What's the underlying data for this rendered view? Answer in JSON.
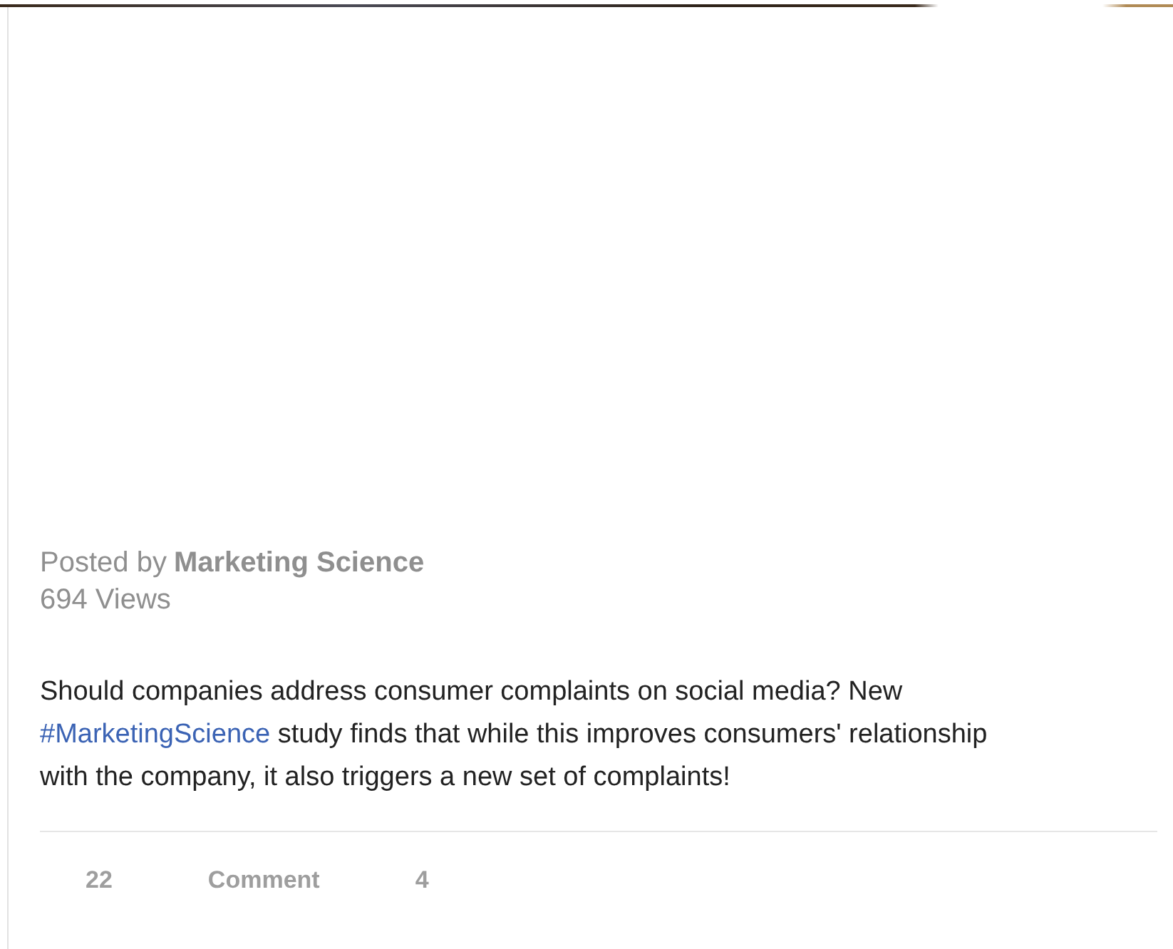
{
  "post": {
    "posted_by_label": "Posted by",
    "author": "Marketing Science",
    "views": "694 Views",
    "body": {
      "before": "Should companies address consumer complaints on social media? New",
      "hashtag": "#MarketingScience",
      "after": "study finds that while this improves consumers' relationship with the company, it also triggers a new set of complaints!"
    },
    "actions": [
      "22",
      "Comment",
      "4"
    ]
  }
}
